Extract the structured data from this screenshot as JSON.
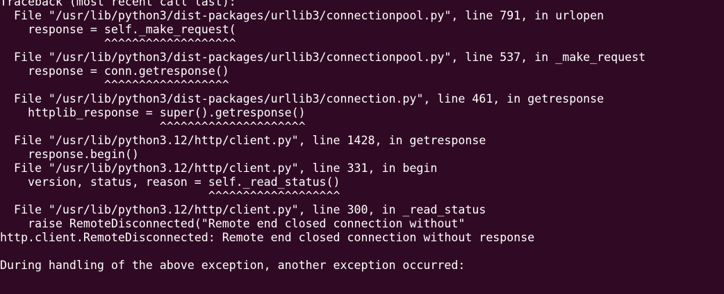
{
  "terminal": {
    "colors": {
      "background": "#300a24",
      "foreground": "#ffffff"
    },
    "lines": [
      "Traceback (most recent call last):",
      "  File \"/usr/lib/python3/dist-packages/urllib3/connectionpool.py\", line 791, in urlopen",
      "    response = self._make_request(",
      "               ^^^^^^^^^^^^^^^^^^^",
      "  File \"/usr/lib/python3/dist-packages/urllib3/connectionpool.py\", line 537, in _make_request",
      "    response = conn.getresponse()",
      "               ^^^^^^^^^^^^^^^^^^",
      "  File \"/usr/lib/python3/dist-packages/urllib3/connection.py\", line 461, in getresponse",
      "    httplib_response = super().getresponse()",
      "                       ^^^^^^^^^^^^^^^^^^^^^",
      "  File \"/usr/lib/python3.12/http/client.py\", line 1428, in getresponse",
      "    response.begin()",
      "  File \"/usr/lib/python3.12/http/client.py\", line 331, in begin",
      "    version, status, reason = self._read_status()",
      "                              ^^^^^^^^^^^^^^^^^^^",
      "  File \"/usr/lib/python3.12/http/client.py\", line 300, in _read_status",
      "    raise RemoteDisconnected(\"Remote end closed connection without\"",
      "http.client.RemoteDisconnected: Remote end closed connection without response",
      "",
      "During handling of the above exception, another exception occurred:",
      ""
    ]
  }
}
